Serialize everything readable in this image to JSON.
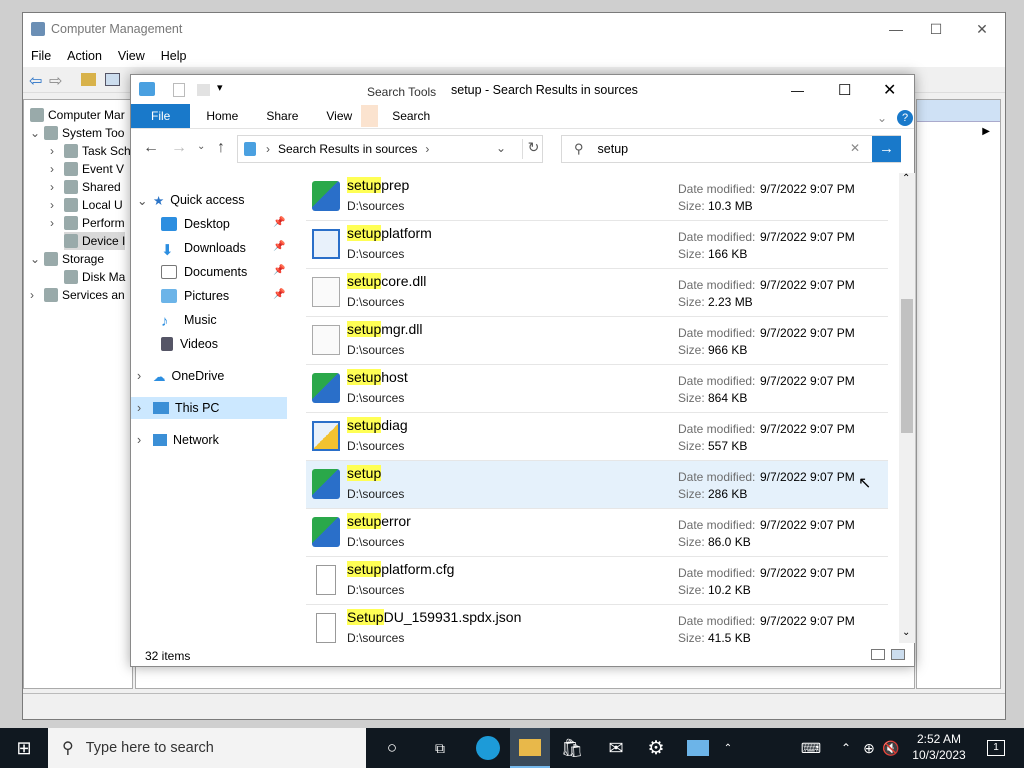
{
  "colors": {
    "accent": "#1979ca",
    "highlight": "#ffff55",
    "selected_row": "#e5f1fb",
    "taskbar": "#101820",
    "context_tab": "#fbe3cf"
  },
  "computer_management": {
    "title": "Computer Management",
    "menu": [
      "File",
      "Action",
      "View",
      "Help"
    ],
    "tree": [
      "Computer Mar",
      "System Too",
      "Task Sch",
      "Event V",
      "Shared",
      "Local U",
      "Perform",
      "Device I",
      "Storage",
      "Disk Ma",
      "Services an"
    ],
    "window_controls": {
      "min": "—",
      "max": "☐",
      "close": "✕"
    }
  },
  "explorer": {
    "title": "setup - Search Results in sources",
    "context_tab_group": "Search Tools",
    "ribbon_tabs": [
      "File",
      "Home",
      "Share",
      "View",
      "Search"
    ],
    "address": {
      "crumb": "Search Results in sources",
      "sep": "›"
    },
    "search_value": "setup",
    "nav": {
      "quick_access": "Quick access",
      "items": [
        "Desktop",
        "Downloads",
        "Documents",
        "Pictures",
        "Music",
        "Videos"
      ],
      "onedrive": "OneDrive",
      "this_pc": "This PC",
      "network": "Network"
    },
    "date_label": "Date modified:",
    "size_label": "Size:",
    "files": [
      {
        "match": "setup",
        "rest": "prep",
        "loc": "D:\\sources",
        "date": "9/7/2022 9:07 PM",
        "size": "10.3 MB",
        "icon": "installer-icon"
      },
      {
        "match": "setup",
        "rest": "platform",
        "loc": "D:\\sources",
        "date": "9/7/2022 9:07 PM",
        "size": "166 KB",
        "icon": "app-window-icon"
      },
      {
        "match": "setup",
        "rest": "core.dll",
        "loc": "D:\\sources",
        "date": "9/7/2022 9:07 PM",
        "size": "2.23 MB",
        "icon": "dll-gear-icon"
      },
      {
        "match": "setup",
        "rest": "mgr.dll",
        "loc": "D:\\sources",
        "date": "9/7/2022 9:07 PM",
        "size": "966 KB",
        "icon": "dll-gear-icon"
      },
      {
        "match": "setup",
        "rest": "host",
        "loc": "D:\\sources",
        "date": "9/7/2022 9:07 PM",
        "size": "864 KB",
        "icon": "installer-icon"
      },
      {
        "match": "setup",
        "rest": "diag",
        "loc": "D:\\sources",
        "date": "9/7/2022 9:07 PM",
        "size": "557 KB",
        "icon": "shield-window-icon"
      },
      {
        "match": "setup",
        "rest": "",
        "loc": "D:\\sources",
        "date": "9/7/2022 9:07 PM",
        "size": "286 KB",
        "icon": "installer-icon"
      },
      {
        "match": "setup",
        "rest": "error",
        "loc": "D:\\sources",
        "date": "9/7/2022 9:07 PM",
        "size": "86.0 KB",
        "icon": "installer-icon"
      },
      {
        "match": "setup",
        "rest": "platform.cfg",
        "loc": "D:\\sources",
        "date": "9/7/2022 9:07 PM",
        "size": "10.2 KB",
        "icon": "file-icon"
      },
      {
        "match": "Setup",
        "rest": "DU_159931.spdx.json",
        "loc": "D:\\sources",
        "date": "9/7/2022 9:07 PM",
        "size": "41.5 KB",
        "icon": "file-icon"
      }
    ],
    "status": "32 items"
  },
  "taskbar": {
    "search_placeholder": "Type here to search",
    "time": "2:52 AM",
    "date": "10/3/2023",
    "notification_count": "1"
  }
}
